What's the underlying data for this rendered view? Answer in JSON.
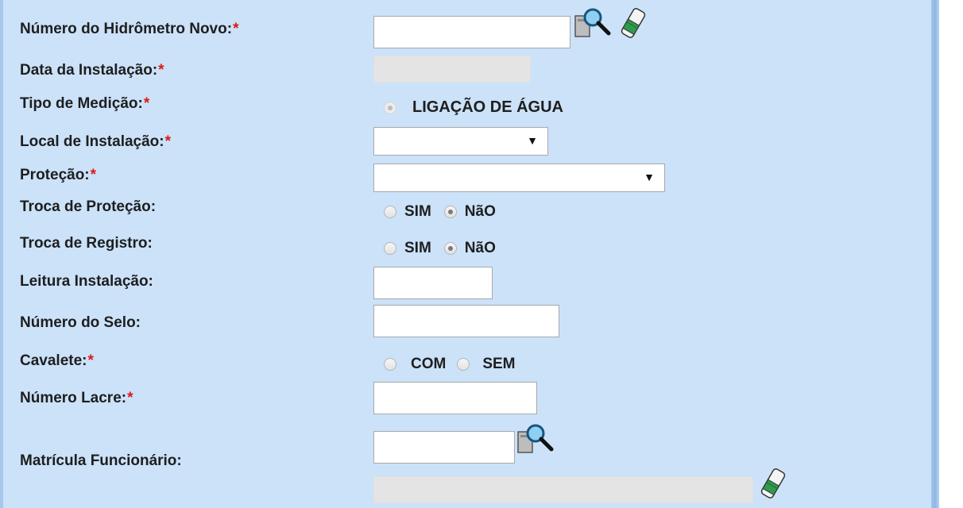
{
  "form": {
    "required_mark": "*",
    "fields": {
      "numero_hidrometro": {
        "label": "Número do Hidrômetro Novo:",
        "value": ""
      },
      "data_instalacao": {
        "label": "Data da Instalação:",
        "value": ""
      },
      "tipo_medicao": {
        "label": "Tipo de Medição:",
        "option": "LIGAÇÃO DE ÁGUA"
      },
      "local_instalacao": {
        "label": "Local de Instalação:",
        "selected": ""
      },
      "protecao": {
        "label": "Proteção:",
        "selected": ""
      },
      "troca_protecao": {
        "label": "Troca de Proteção:",
        "option_yes": "SIM",
        "option_no": "NãO",
        "selected": "NãO"
      },
      "troca_registro": {
        "label": "Troca de Registro:",
        "option_yes": "SIM",
        "option_no": "NãO",
        "selected": "NãO"
      },
      "leitura_instalacao": {
        "label": "Leitura Instalação:",
        "value": ""
      },
      "numero_selo": {
        "label": "Número do Selo:",
        "value": ""
      },
      "cavalete": {
        "label": "Cavalete:",
        "option_com": "COM",
        "option_sem": "SEM",
        "selected": ""
      },
      "numero_lacre": {
        "label": "Número Lacre:",
        "value": ""
      },
      "matricula_funcionario": {
        "label": "Matrícula Funcionário:",
        "value": "",
        "name_value": ""
      }
    }
  },
  "colors": {
    "background": "#cbe2f9",
    "required": "#e01717",
    "search_lens": "#1f7fb8",
    "eraser_green": "#2f9a4a"
  },
  "icons": [
    "search-icon",
    "eraser-icon"
  ]
}
